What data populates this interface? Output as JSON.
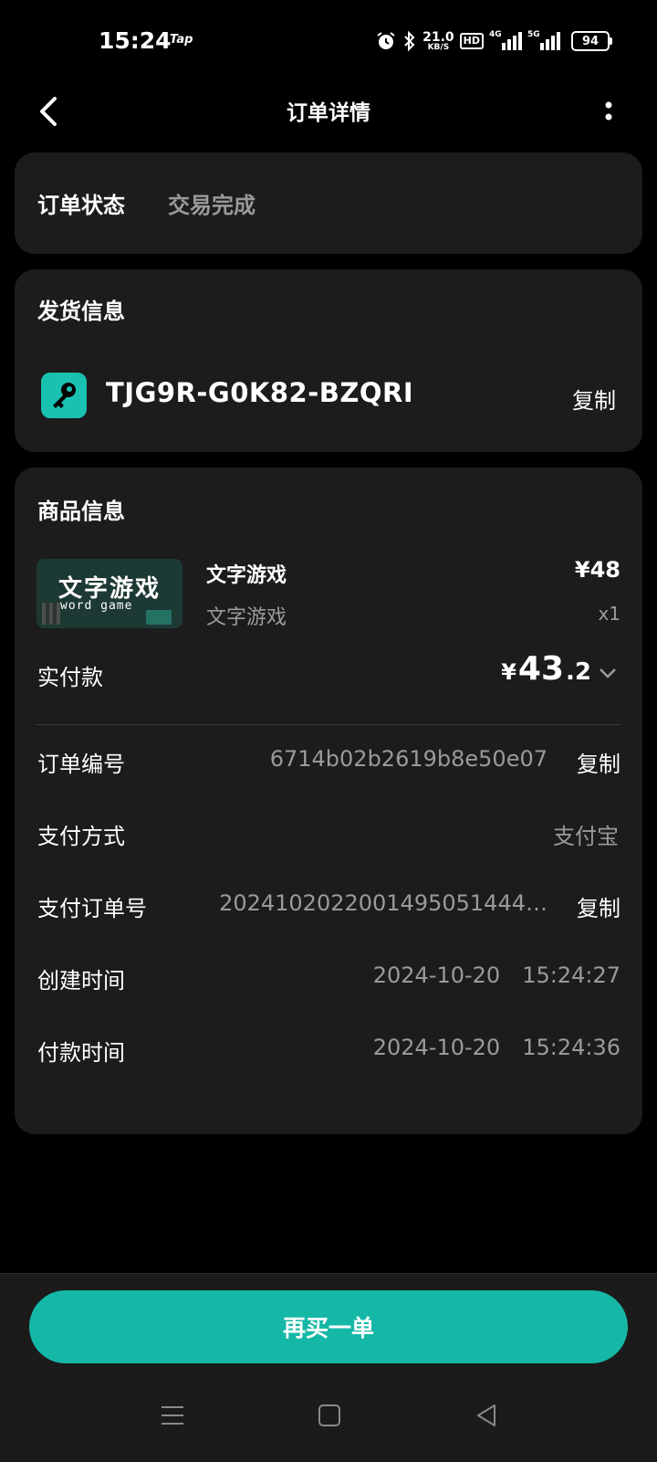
{
  "status_bar": {
    "time": "15:24",
    "tap_label": "Tap",
    "net_speed": "21.0",
    "net_unit": "KB/S",
    "hd_label": "HD",
    "signal1_label": "4G",
    "signal2_label": "5G",
    "battery": "94"
  },
  "header": {
    "title": "订单详情",
    "back_icon": "chevron-left-icon",
    "more_icon": "more-vertical-icon"
  },
  "order_status": {
    "label": "订单状态",
    "value": "交易完成"
  },
  "delivery": {
    "title": "发货信息",
    "key_icon": "key-icon",
    "code": "TJG9R-G0K82-BZQRI",
    "copy_label": "复制"
  },
  "product": {
    "title": "商品信息",
    "thumb_text_main": "文字游戏",
    "thumb_text_sub": "word game",
    "name": "文字游戏",
    "subtitle": "文字游戏",
    "price": "¥48",
    "quantity": "x1",
    "paid_label": "实付款",
    "paid_currency": "¥",
    "paid_int": "43",
    "paid_dec": ".2"
  },
  "details": {
    "order_no_label": "订单编号",
    "order_no": "6714b02b2619b8e50e07",
    "order_no_copy": "复制",
    "pay_method_label": "支付方式",
    "pay_method": "支付宝",
    "pay_order_label": "支付订单号",
    "pay_order": "2024102022001495051444…",
    "pay_order_copy": "复制",
    "created_label": "创建时间",
    "created_date": "2024-10-20",
    "created_time": "15:24:27",
    "paid_time_label": "付款时间",
    "paid_date": "2024-10-20",
    "paid_time": "15:24:36"
  },
  "footer": {
    "rebuy_label": "再买一单"
  },
  "colors": {
    "accent": "#15b8a6",
    "card_bg": "#1c1c1c",
    "secondary_text": "#9a9a9a"
  }
}
